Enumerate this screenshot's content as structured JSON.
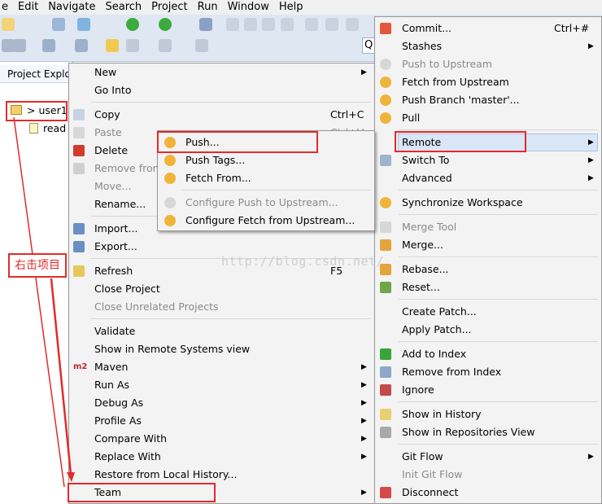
{
  "menubar": [
    "e",
    "Edit",
    "Navigate",
    "Search",
    "Project",
    "Run",
    "Window",
    "Help"
  ],
  "explorer": {
    "tab_label": "Project Explor",
    "project_label": "> user1",
    "child_label": "read",
    "search_stub": "Q"
  },
  "context_menu": [
    {
      "label": "New",
      "submenu": true
    },
    {
      "label": "Go Into"
    },
    {
      "label": "Copy",
      "accel": "Ctrl+C"
    },
    {
      "label": "Paste",
      "accel": "Ctrl+V",
      "disabled": true
    },
    {
      "label": "Delete"
    },
    {
      "label": "Remove from",
      "disabled": true
    },
    {
      "label": "Move...",
      "disabled": true
    },
    {
      "label": "Rename..."
    },
    {
      "label": "Import..."
    },
    {
      "label": "Export..."
    },
    {
      "label": "Refresh",
      "accel": "F5"
    },
    {
      "label": "Close Project"
    },
    {
      "label": "Close Unrelated Projects",
      "disabled": true
    },
    {
      "label": "Validate"
    },
    {
      "label": "Show in Remote Systems view"
    },
    {
      "label": "Maven",
      "submenu": true,
      "icon_text": "m2"
    },
    {
      "label": "Run As",
      "submenu": true
    },
    {
      "label": "Debug As",
      "submenu": true
    },
    {
      "label": "Profile As",
      "submenu": true
    },
    {
      "label": "Compare With",
      "submenu": true
    },
    {
      "label": "Replace With",
      "submenu": true
    },
    {
      "label": "Restore from Local History..."
    },
    {
      "label": "Team",
      "submenu": true
    }
  ],
  "team_menu": [
    {
      "label": "Commit...",
      "accel": "Ctrl+#"
    },
    {
      "label": "Stashes",
      "submenu": true
    },
    {
      "label": "Push to Upstream",
      "disabled": true
    },
    {
      "label": "Fetch from Upstream"
    },
    {
      "label": "Push Branch 'master'..."
    },
    {
      "label": "Pull"
    },
    {
      "label": "Remote",
      "submenu": true
    },
    {
      "label": "Switch To",
      "submenu": true
    },
    {
      "label": "Advanced",
      "submenu": true
    },
    {
      "label": "Synchronize Workspace"
    },
    {
      "label": "Merge Tool",
      "disabled": true
    },
    {
      "label": "Merge..."
    },
    {
      "label": "Rebase..."
    },
    {
      "label": "Reset..."
    },
    {
      "label": "Create Patch..."
    },
    {
      "label": "Apply Patch..."
    },
    {
      "label": "Add to Index"
    },
    {
      "label": "Remove from Index"
    },
    {
      "label": "Ignore"
    },
    {
      "label": "Show in History"
    },
    {
      "label": "Show in Repositories View"
    },
    {
      "label": "Git Flow",
      "submenu": true
    },
    {
      "label": "Init Git Flow",
      "disabled": true
    },
    {
      "label": "Disconnect"
    }
  ],
  "remote_menu": [
    {
      "label": "Push..."
    },
    {
      "label": "Push Tags..."
    },
    {
      "label": "Fetch From..."
    },
    {
      "label": "Configure Push to Upstream...",
      "disabled": true
    },
    {
      "label": "Configure Fetch from Upstream..."
    }
  ],
  "annotation": "右击项目",
  "watermark": "http://blog.csdn.net/"
}
